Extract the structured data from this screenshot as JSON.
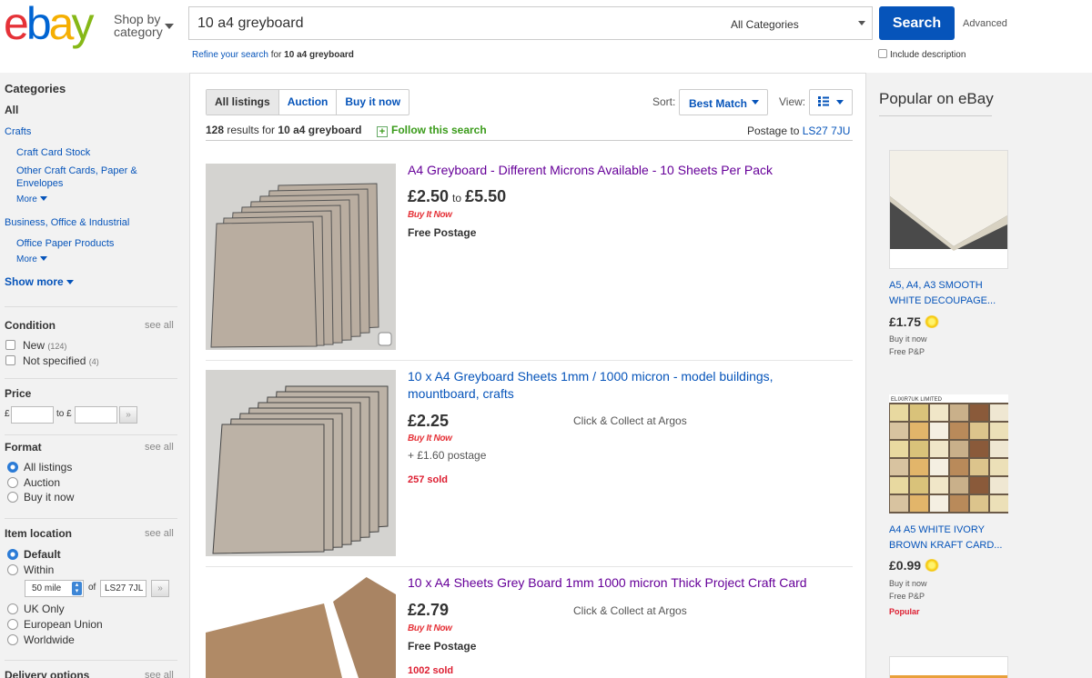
{
  "header": {
    "logo": {
      "e": "e",
      "b": "b",
      "a": "a",
      "y": "y"
    },
    "shop_by": "Shop by",
    "category": "category",
    "search_value": "10 a4 greyboard",
    "category_select": "All Categories",
    "search_button": "Search",
    "advanced": "Advanced",
    "refine_prefix": "Refine your search",
    "refine_for": "for",
    "refine_query": "10 a4 greyboard",
    "include_description": "Include description"
  },
  "sidebar": {
    "categories_heading": "Categories",
    "all": "All",
    "crafts": "Crafts",
    "craft_card_stock": "Craft Card Stock",
    "other_craft_cards_1": "Other Craft Cards, Paper &",
    "other_craft_cards_2": "Envelopes",
    "more_1": "More",
    "business": "Business, Office & Industrial",
    "office_paper": "Office Paper Products",
    "more_2": "More",
    "show_more": "Show more",
    "condition_heading": "Condition",
    "see_all": "see all",
    "cond_new": "New",
    "cond_new_count": "(124)",
    "cond_ns": "Not specified",
    "cond_ns_count": "(4)",
    "price_heading": "Price",
    "currency": "£",
    "to": "to £",
    "format_heading": "Format",
    "fmt_all": "All listings",
    "fmt_auction": "Auction",
    "fmt_bin": "Buy it now",
    "location_heading": "Item location",
    "loc_default": "Default",
    "loc_within": "Within",
    "miles": "50 mile",
    "of": "of",
    "postcode": "LS27 7JL",
    "loc_uk": "UK Only",
    "loc_eu": "European Union",
    "loc_world": "Worldwide",
    "delivery_heading": "Delivery options"
  },
  "results": {
    "tabs": [
      "All listings",
      "Auction",
      "Buy it now"
    ],
    "sort_label": "Sort:",
    "sort_value": "Best Match",
    "view_label": "View:",
    "count": "128",
    "count_text": "results for",
    "query": "10 a4 greyboard",
    "follow": "Follow this search",
    "postage_to": "Postage to",
    "postcode": "LS27 7JU",
    "buy_it_now_logo": "Buy It Now",
    "items": [
      {
        "title": "A4 Greyboard - Different Microns Available - 10 Sheets Per Pack",
        "price_low": "£2.50",
        "price_to": "to",
        "price_high": "£5.50",
        "shipping": "Free Postage"
      },
      {
        "title_1": "10 x A4 Greyboard Sheets 1mm / 1000 micron - model buildings,",
        "title_2": "mountboard, crafts",
        "price": "£2.25",
        "collect": "Click & Collect at Argos",
        "shipping": "+ £1.60 postage",
        "sold": "257 sold"
      },
      {
        "title": "10 x A4 Sheets Grey Board 1mm 1000 micron Thick Project Craft Card",
        "price": "£2.79",
        "collect": "Click & Collect at Argos",
        "shipping": "Free Postage",
        "sold": "1002 sold"
      }
    ]
  },
  "popular": {
    "heading": "Popular on eBay",
    "items": [
      {
        "title_1": "A5, A4, A3 SMOOTH",
        "title_2": "WHITE DECOUPAGE...",
        "price": "£1.75",
        "format": "Buy it now",
        "shipping": "Free P&P"
      },
      {
        "title_1": "A4 A5 WHITE IVORY",
        "title_2": "BROWN KRAFT CARD...",
        "price": "£0.99",
        "format": "Buy it now",
        "shipping": "Free P&P",
        "badge": "Popular",
        "image_label": "ELIXIR7UK LIMITED"
      }
    ]
  },
  "colors": {
    "accent": "#0654ba",
    "sold": "#dd1e31",
    "follow": "#3a9b1a",
    "visited": "#660099"
  }
}
